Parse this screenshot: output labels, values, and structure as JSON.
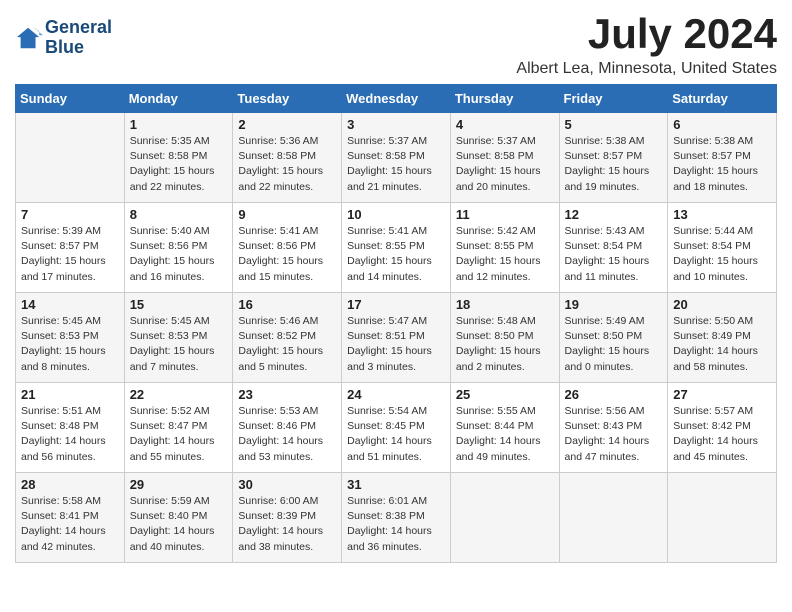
{
  "header": {
    "logo_line1": "General",
    "logo_line2": "Blue",
    "title": "July 2024",
    "subtitle": "Albert Lea, Minnesota, United States"
  },
  "columns": [
    "Sunday",
    "Monday",
    "Tuesday",
    "Wednesday",
    "Thursday",
    "Friday",
    "Saturday"
  ],
  "weeks": [
    [
      {
        "day": "",
        "info": ""
      },
      {
        "day": "1",
        "info": "Sunrise: 5:35 AM\nSunset: 8:58 PM\nDaylight: 15 hours\nand 22 minutes."
      },
      {
        "day": "2",
        "info": "Sunrise: 5:36 AM\nSunset: 8:58 PM\nDaylight: 15 hours\nand 22 minutes."
      },
      {
        "day": "3",
        "info": "Sunrise: 5:37 AM\nSunset: 8:58 PM\nDaylight: 15 hours\nand 21 minutes."
      },
      {
        "day": "4",
        "info": "Sunrise: 5:37 AM\nSunset: 8:58 PM\nDaylight: 15 hours\nand 20 minutes."
      },
      {
        "day": "5",
        "info": "Sunrise: 5:38 AM\nSunset: 8:57 PM\nDaylight: 15 hours\nand 19 minutes."
      },
      {
        "day": "6",
        "info": "Sunrise: 5:38 AM\nSunset: 8:57 PM\nDaylight: 15 hours\nand 18 minutes."
      }
    ],
    [
      {
        "day": "7",
        "info": "Sunrise: 5:39 AM\nSunset: 8:57 PM\nDaylight: 15 hours\nand 17 minutes."
      },
      {
        "day": "8",
        "info": "Sunrise: 5:40 AM\nSunset: 8:56 PM\nDaylight: 15 hours\nand 16 minutes."
      },
      {
        "day": "9",
        "info": "Sunrise: 5:41 AM\nSunset: 8:56 PM\nDaylight: 15 hours\nand 15 minutes."
      },
      {
        "day": "10",
        "info": "Sunrise: 5:41 AM\nSunset: 8:55 PM\nDaylight: 15 hours\nand 14 minutes."
      },
      {
        "day": "11",
        "info": "Sunrise: 5:42 AM\nSunset: 8:55 PM\nDaylight: 15 hours\nand 12 minutes."
      },
      {
        "day": "12",
        "info": "Sunrise: 5:43 AM\nSunset: 8:54 PM\nDaylight: 15 hours\nand 11 minutes."
      },
      {
        "day": "13",
        "info": "Sunrise: 5:44 AM\nSunset: 8:54 PM\nDaylight: 15 hours\nand 10 minutes."
      }
    ],
    [
      {
        "day": "14",
        "info": "Sunrise: 5:45 AM\nSunset: 8:53 PM\nDaylight: 15 hours\nand 8 minutes."
      },
      {
        "day": "15",
        "info": "Sunrise: 5:45 AM\nSunset: 8:53 PM\nDaylight: 15 hours\nand 7 minutes."
      },
      {
        "day": "16",
        "info": "Sunrise: 5:46 AM\nSunset: 8:52 PM\nDaylight: 15 hours\nand 5 minutes."
      },
      {
        "day": "17",
        "info": "Sunrise: 5:47 AM\nSunset: 8:51 PM\nDaylight: 15 hours\nand 3 minutes."
      },
      {
        "day": "18",
        "info": "Sunrise: 5:48 AM\nSunset: 8:50 PM\nDaylight: 15 hours\nand 2 minutes."
      },
      {
        "day": "19",
        "info": "Sunrise: 5:49 AM\nSunset: 8:50 PM\nDaylight: 15 hours\nand 0 minutes."
      },
      {
        "day": "20",
        "info": "Sunrise: 5:50 AM\nSunset: 8:49 PM\nDaylight: 14 hours\nand 58 minutes."
      }
    ],
    [
      {
        "day": "21",
        "info": "Sunrise: 5:51 AM\nSunset: 8:48 PM\nDaylight: 14 hours\nand 56 minutes."
      },
      {
        "day": "22",
        "info": "Sunrise: 5:52 AM\nSunset: 8:47 PM\nDaylight: 14 hours\nand 55 minutes."
      },
      {
        "day": "23",
        "info": "Sunrise: 5:53 AM\nSunset: 8:46 PM\nDaylight: 14 hours\nand 53 minutes."
      },
      {
        "day": "24",
        "info": "Sunrise: 5:54 AM\nSunset: 8:45 PM\nDaylight: 14 hours\nand 51 minutes."
      },
      {
        "day": "25",
        "info": "Sunrise: 5:55 AM\nSunset: 8:44 PM\nDaylight: 14 hours\nand 49 minutes."
      },
      {
        "day": "26",
        "info": "Sunrise: 5:56 AM\nSunset: 8:43 PM\nDaylight: 14 hours\nand 47 minutes."
      },
      {
        "day": "27",
        "info": "Sunrise: 5:57 AM\nSunset: 8:42 PM\nDaylight: 14 hours\nand 45 minutes."
      }
    ],
    [
      {
        "day": "28",
        "info": "Sunrise: 5:58 AM\nSunset: 8:41 PM\nDaylight: 14 hours\nand 42 minutes."
      },
      {
        "day": "29",
        "info": "Sunrise: 5:59 AM\nSunset: 8:40 PM\nDaylight: 14 hours\nand 40 minutes."
      },
      {
        "day": "30",
        "info": "Sunrise: 6:00 AM\nSunset: 8:39 PM\nDaylight: 14 hours\nand 38 minutes."
      },
      {
        "day": "31",
        "info": "Sunrise: 6:01 AM\nSunset: 8:38 PM\nDaylight: 14 hours\nand 36 minutes."
      },
      {
        "day": "",
        "info": ""
      },
      {
        "day": "",
        "info": ""
      },
      {
        "day": "",
        "info": ""
      }
    ]
  ]
}
